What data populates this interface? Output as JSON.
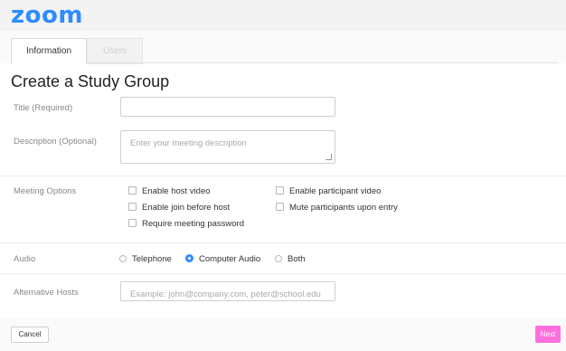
{
  "app": {
    "logo": "zoom"
  },
  "tabs": [
    {
      "label": "Information",
      "active": true
    },
    {
      "label": "Users",
      "active": false
    }
  ],
  "page": {
    "title": "Create a Study Group"
  },
  "form": {
    "title_label": "Title (Required)",
    "title_value": "",
    "description_label": "Description (Optional)",
    "description_placeholder": "Enter your meeting description",
    "meeting_options_label": "Meeting Options",
    "options": [
      "Enable host video",
      "Enable participant video",
      "Enable join before host",
      "Mute participants upon entry",
      "Require meeting password"
    ],
    "audio_label": "Audio",
    "audio_options": [
      "Telephone",
      "Computer Audio",
      "Both"
    ],
    "audio_selected": "Computer Audio",
    "alt_hosts_label": "Alternative Hosts",
    "alt_hosts_placeholder": "Example: john@company.com, peter@school.edu"
  },
  "footer": {
    "cancel_label": "Cancel",
    "next_label": "Next"
  },
  "colors": {
    "brand": "#2d8cff",
    "next_button": "#ff6fe0"
  }
}
